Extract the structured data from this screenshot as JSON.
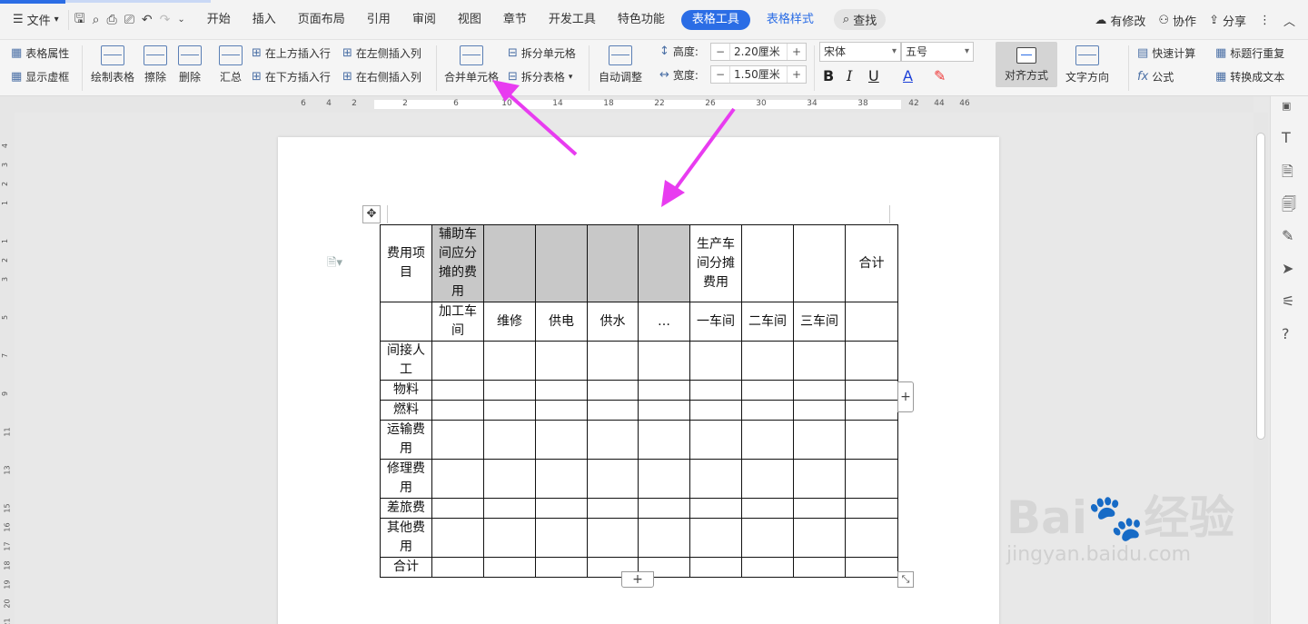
{
  "menu": {
    "file": "文件",
    "tabs": [
      "开始",
      "插入",
      "页面布局",
      "引用",
      "审阅",
      "视图",
      "章节",
      "开发工具",
      "特色功能"
    ],
    "active_tab": "表格工具",
    "extra_tab": "表格样式",
    "search": "查找",
    "right": {
      "modified": "有修改",
      "collab": "协作",
      "share": "分享"
    }
  },
  "ribbon": {
    "table_props": "表格属性",
    "show_gridlines": "显示虚框",
    "draw_table": "绘制表格",
    "erase": "擦除",
    "delete": "删除",
    "summary": "汇总",
    "insert_above": "在上方插入行",
    "insert_below": "在下方插入行",
    "insert_left": "在左侧插入列",
    "insert_right": "在右侧插入列",
    "merge_cells": "合并单元格",
    "split_cells": "拆分单元格",
    "split_table": "拆分表格",
    "auto_fit": "自动调整",
    "height_label": "高度:",
    "height_value": "2.20厘米",
    "width_label": "宽度:",
    "width_value": "1.50厘米",
    "font_name": "宋体",
    "font_size": "五号",
    "align": "对齐方式",
    "text_direction": "文字方向",
    "quick_calc": "快速计算",
    "title_repeat": "标题行重复",
    "formula": "公式",
    "to_text": "转换成文本"
  },
  "ruler": [
    "6",
    "4",
    "2",
    "",
    "2",
    "",
    "6",
    "",
    "10",
    "",
    "14",
    "",
    "18",
    "",
    "22",
    "",
    "26",
    "",
    "30",
    "",
    "34",
    "",
    "38",
    "",
    "42",
    "44",
    "46"
  ],
  "vruler": [
    "4",
    "3",
    "2",
    "1",
    "",
    "1",
    "2",
    "3",
    "",
    "5",
    "",
    "7",
    "",
    "9",
    "",
    "11",
    "",
    "13",
    "",
    "15",
    "16",
    "17",
    "18",
    "19",
    "20",
    "21"
  ],
  "table": {
    "header1": [
      "费用项目",
      "辅助车间应分摊的费用",
      "",
      "",
      "",
      "",
      "生产车间分摊费用",
      "",
      "",
      "合计"
    ],
    "header2": [
      "",
      "加工车间",
      "维修",
      "供电",
      "供水",
      "…",
      "一车间",
      "二车间",
      "三车间",
      ""
    ],
    "row_labels": [
      "间接人工",
      "物料",
      "燃料",
      "运输费用",
      "修理费用",
      "差旅费",
      "其他费用",
      "合计"
    ]
  },
  "watermark": {
    "brand": "Bai",
    "brand_cn": "经验",
    "url": "jingyan.baidu.com"
  },
  "colors": {
    "accent": "#2b6de5",
    "shade": "#c8c8c8",
    "arrow": "#e83cf0"
  }
}
